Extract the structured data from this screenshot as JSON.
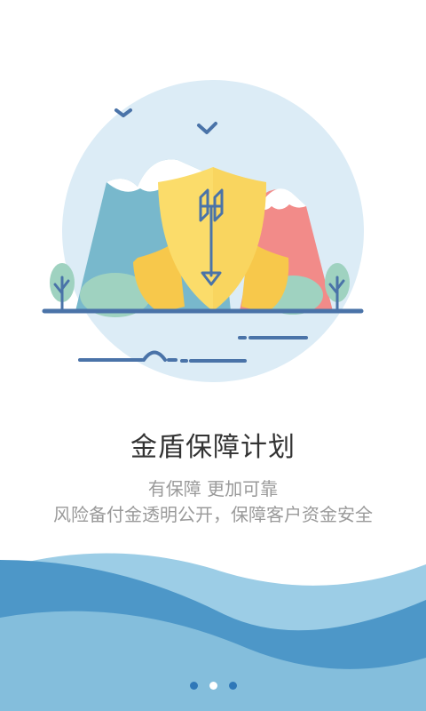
{
  "onboarding": {
    "title": "金盾保障计划",
    "subtitle": "有保障 更加可靠",
    "description": "风险备付金透明公开，保障客户资金安全"
  },
  "pager": {
    "total": 3,
    "active_index": 1
  },
  "colors": {
    "circle": "#dcecf6",
    "mountain_blue": "#78b8cc",
    "mountain_red": "#f28b89",
    "shield": "#fbdc6a",
    "accent_dark": "#4a73a8",
    "wave_back": "#9ccde6",
    "wave_mid": "#4d97c8",
    "wave_front": "#84bedc"
  },
  "icons": {
    "main": "shield-arrow-icon",
    "birds": "bird-icon"
  }
}
